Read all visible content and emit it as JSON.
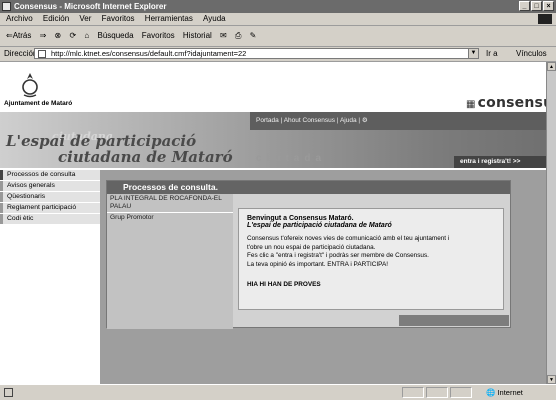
{
  "window": {
    "title": "Consensus - Microsoft Internet Explorer"
  },
  "menu": [
    "Archivo",
    "Edición",
    "Ver",
    "Favoritos",
    "Herramientas",
    "Ayuda"
  ],
  "toolbar": {
    "back": "⇐Atrás",
    "forward": "⇒",
    "search": "Búsqueda",
    "favorites": "Favoritos",
    "history": "Historial"
  },
  "address": {
    "label": "Dirección",
    "url": "http://mlc.ktnet.es/consensus/default.cmf?idajuntament=22",
    "go": "Ir a",
    "links": "Vínculos"
  },
  "page": {
    "emblem_label": "Ajuntament de Mataró",
    "brand": "consensus",
    "top_links": "Portada | Ahout Consensus | Ajuda | ⚙",
    "banner_line1": "L'espai de participació",
    "banner_line2": "ciutadana de Mataró",
    "banner_ghost": "ciutadana",
    "banner_tag": "ciutada",
    "register": "entra i registra't! >>",
    "nav": [
      "Processos de consulta",
      "Avisos generals",
      "Qüestionaris",
      "Reglament participació",
      "Codi ètic"
    ],
    "panel_title": "Processos de consulta.",
    "processes": [
      {
        "label": "PLA INTEGRAL DE ROCAFONDA-EL PALAU"
      },
      {
        "label": "Grup Promotor"
      }
    ],
    "welcome": {
      "title": "Benvingut a Consensus Mataró.",
      "subtitle": "L'espai de participació ciutadana de Mataró",
      "paragraphs": [
        "Consensus t'ofereix noves vies de comunicació amb el teu ajuntament i",
        "t'obre un nou espai de participació ciutadana.",
        "Fes clic a \"entra i registra't\" i podràs ser membre de Consensus.",
        "La teva opinió és important. ENTRA i PARTICIPA!"
      ],
      "link": "HIA HI HAN DE PROVES"
    }
  },
  "status": {
    "zone": "Internet"
  }
}
